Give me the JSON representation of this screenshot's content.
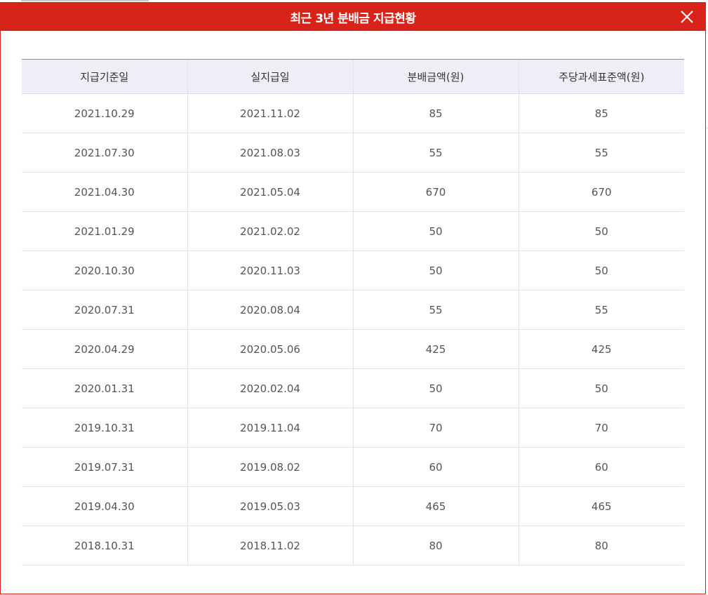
{
  "dialog": {
    "title": "최근 3년 분배금 지급현황",
    "close_icon": "close-icon"
  },
  "table": {
    "headers": [
      "지급기준일",
      "실지급일",
      "분배금액(원)",
      "주당과세표준액(원)"
    ],
    "rows": [
      [
        "2021.10.29",
        "2021.11.02",
        "85",
        "85"
      ],
      [
        "2021.07.30",
        "2021.08.03",
        "55",
        "55"
      ],
      [
        "2021.04.30",
        "2021.05.04",
        "670",
        "670"
      ],
      [
        "2021.01.29",
        "2021.02.02",
        "50",
        "50"
      ],
      [
        "2020.10.30",
        "2020.11.03",
        "50",
        "50"
      ],
      [
        "2020.07.31",
        "2020.08.04",
        "55",
        "55"
      ],
      [
        "2020.04.29",
        "2020.05.06",
        "425",
        "425"
      ],
      [
        "2020.01.31",
        "2020.02.04",
        "50",
        "50"
      ],
      [
        "2019.10.31",
        "2019.11.04",
        "70",
        "70"
      ],
      [
        "2019.07.31",
        "2019.08.02",
        "60",
        "60"
      ],
      [
        "2019.04.30",
        "2019.05.03",
        "465",
        "465"
      ],
      [
        "2018.10.31",
        "2018.11.02",
        "80",
        "80"
      ]
    ]
  },
  "colors": {
    "header_red": "#d8231a",
    "table_head_bg": "#eeeff6"
  }
}
